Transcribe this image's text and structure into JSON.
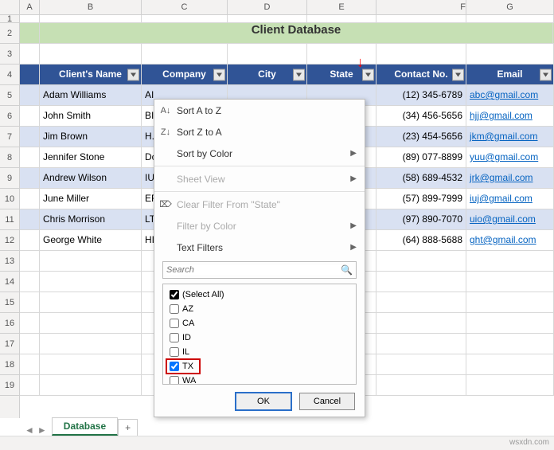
{
  "columns": [
    "A",
    "B",
    "C",
    "D",
    "E",
    "F",
    "G"
  ],
  "rows": [
    "1",
    "2",
    "3",
    "4",
    "5",
    "6",
    "7",
    "8",
    "9",
    "10",
    "11",
    "12",
    "13",
    "14",
    "15",
    "16",
    "17",
    "18",
    "19"
  ],
  "title": "Client Database",
  "headers": {
    "name": "Client's Name",
    "company": "Company",
    "city": "City",
    "state": "State",
    "contact": "Contact No.",
    "email": "Email"
  },
  "data": [
    {
      "name": "Adam Williams",
      "company": "AI",
      "contact": "(12) 345-6789",
      "email": "abc@gmail.com"
    },
    {
      "name": "John Smith",
      "company": "BI",
      "contact": "(34) 456-5656",
      "email": "hjj@gmail.com"
    },
    {
      "name": "Jim Brown",
      "company": "H.",
      "contact": "(23) 454-5656",
      "email": "jkm@gmail.com"
    },
    {
      "name": "Jennifer Stone",
      "company": "Dc",
      "contact": "(89) 077-8899",
      "email": "yuu@gmail.com"
    },
    {
      "name": "Andrew Wilson",
      "company": "IU",
      "contact": "(58) 689-4532",
      "email": "jrk@gmail.com"
    },
    {
      "name": "June Miller",
      "company": "EF",
      "contact": "(57) 899-7999",
      "email": "iuj@gmail.com"
    },
    {
      "name": "Chris Morrison",
      "company": "LT",
      "contact": "(97) 890-7070",
      "email": "uio@gmail.com"
    },
    {
      "name": "George White",
      "company": "HI",
      "contact": "(64) 888-5688",
      "email": "ght@gmail.com"
    }
  ],
  "menu": {
    "sortAZ": "Sort A to Z",
    "sortZA": "Sort Z to A",
    "sortColor": "Sort by Color",
    "sheetView": "Sheet View",
    "clearFilter": "Clear Filter From \"State\"",
    "filterColor": "Filter by Color",
    "textFilters": "Text Filters",
    "searchPlaceholder": "Search",
    "selectAll": "(Select All)",
    "options": [
      "AZ",
      "CA",
      "ID",
      "IL",
      "TX",
      "WA"
    ],
    "ok": "OK",
    "cancel": "Cancel"
  },
  "tabs": {
    "active": "Database",
    "plus": "+"
  },
  "watermark": "wsxdn.com"
}
